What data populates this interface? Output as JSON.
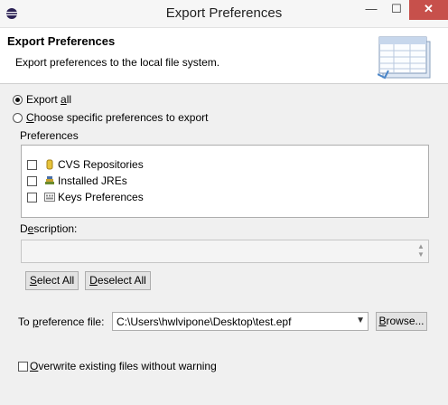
{
  "window": {
    "title": "Export Preferences",
    "controls": {
      "minimize": "—",
      "maximize": "☐",
      "close": "✕"
    }
  },
  "banner": {
    "title": "Export Preferences",
    "subtitle": "Export preferences to the local file system."
  },
  "options": {
    "export_all": {
      "pre": "Export ",
      "u": "a",
      "post": "ll",
      "selected": true
    },
    "choose_specific": {
      "pre": "",
      "u": "C",
      "post": "hoose specific preferences to export",
      "selected": false
    }
  },
  "preferences": {
    "group_label": "Preferences",
    "items": [
      {
        "label": "CVS Repositories",
        "checked": false,
        "icon": "cvs-repository-icon"
      },
      {
        "label": "Installed JREs",
        "checked": false,
        "icon": "jre-library-icon"
      },
      {
        "label": "Keys Preferences",
        "checked": false,
        "icon": "keys-preferences-icon"
      }
    ],
    "description_label": {
      "pre": "D",
      "u": "e",
      "post": "scription:"
    },
    "description_value": "",
    "select_all": {
      "u": "S",
      "post": "elect All"
    },
    "deselect_all": {
      "u": "D",
      "post": "eselect All"
    }
  },
  "file": {
    "label": {
      "pre": "To ",
      "u": "p",
      "post": "reference file:"
    },
    "value": "C:\\Users\\hwlvipone\\Desktop\\test.epf",
    "browse": {
      "u": "B",
      "post": "rowse..."
    }
  },
  "overwrite": {
    "label": {
      "u": "O",
      "post": "verwrite existing files without warning"
    },
    "checked": false
  },
  "colors": {
    "close_button": "#c7504b",
    "dialog_bg": "#f0f0f0"
  }
}
